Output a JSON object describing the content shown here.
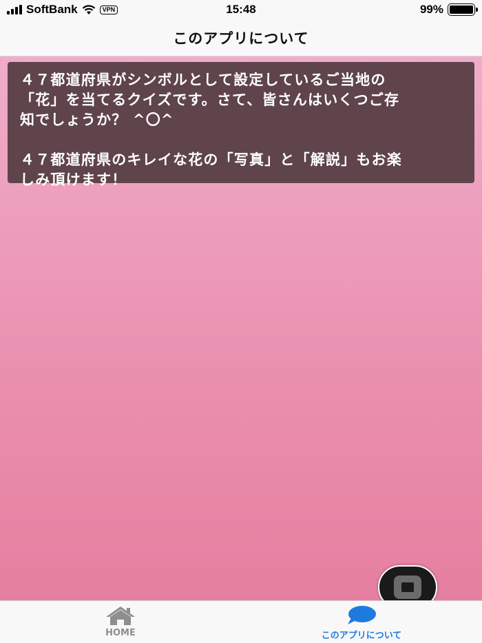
{
  "status_bar": {
    "carrier": "SoftBank",
    "vpn": "VPN",
    "time": "15:48",
    "battery": "99%",
    "battery_level": 0.99
  },
  "nav": {
    "title": "このアプリについて"
  },
  "card": {
    "paragraph1": "４７都道府県がシンボルとして設定しているご当地の\n「花」を当てるクイズです。さて、皆さんはいくつご存\n知でしょうか？ ^〇^",
    "paragraph2": "４７都道府県のキレイな花の「写真」と「解説」もお楽\nしみ頂けます！"
  },
  "tabs": [
    {
      "label": "HOME",
      "icon": "home-icon",
      "active": false
    },
    {
      "label": "このアプリについて",
      "icon": "chat-bubble-icon",
      "active": true
    }
  ],
  "colors": {
    "card_bg": "#5f444c",
    "background_top": "#efadc9",
    "background_bottom": "#e67fa0",
    "active_tab": "#1f7ae0",
    "inactive_tab": "#8e8e8e"
  }
}
